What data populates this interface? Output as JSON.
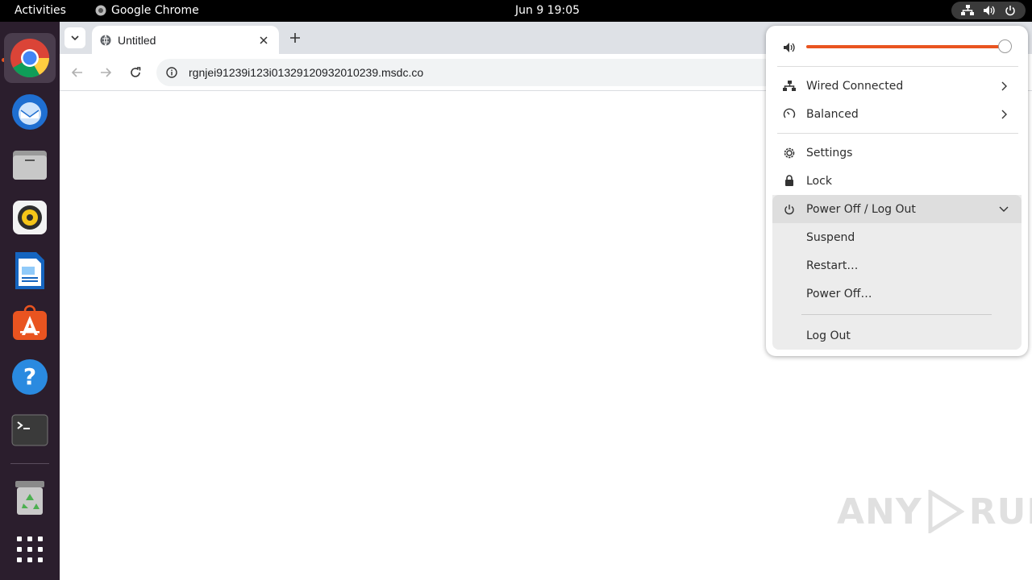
{
  "topbar": {
    "activities": "Activities",
    "app_name": "Google Chrome",
    "clock": "Jun 9  19:05"
  },
  "dock": {
    "apps": [
      "chrome-icon",
      "thunderbird-icon",
      "files-icon",
      "rhythmbox-icon",
      "writer-icon",
      "app-center-icon",
      "help-icon",
      "terminal-icon",
      "trash-icon",
      "app-grid-icon"
    ]
  },
  "browser": {
    "tab_title": "Untitled",
    "url": "rgnjei91239i123i01329120932010239.msdc.co"
  },
  "menu": {
    "volume_percent": 100,
    "wired": "Wired Connected",
    "power_mode": "Balanced",
    "settings": "Settings",
    "lock": "Lock",
    "power_header": "Power Off / Log Out",
    "suspend": "Suspend",
    "restart": "Restart…",
    "power_off": "Power Off…",
    "log_out": "Log Out"
  },
  "watermark": {
    "left": "ANY",
    "right": "RUN"
  },
  "colors": {
    "accent": "#e95420",
    "dock_bg": "#2b1e2d",
    "topbar_bg": "#000000"
  }
}
